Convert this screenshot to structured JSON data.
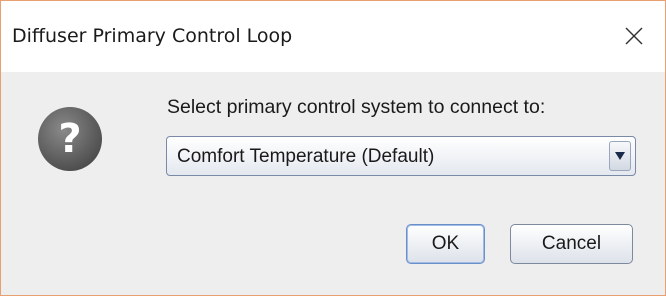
{
  "window": {
    "title": "Diffuser Primary Control Loop"
  },
  "dialog": {
    "prompt": "Select primary control system to connect to:",
    "icon": "question-icon",
    "combo": {
      "selected": "Comfort Temperature (Default)"
    },
    "buttons": {
      "ok": "OK",
      "cancel": "Cancel"
    }
  },
  "colors": {
    "window_border": "#e8a070",
    "content_bg": "#eeeeee",
    "titlebar_bg": "#ffffff",
    "icon_bg": "#5a5a5a",
    "focus_border": "#6b8fc9"
  }
}
